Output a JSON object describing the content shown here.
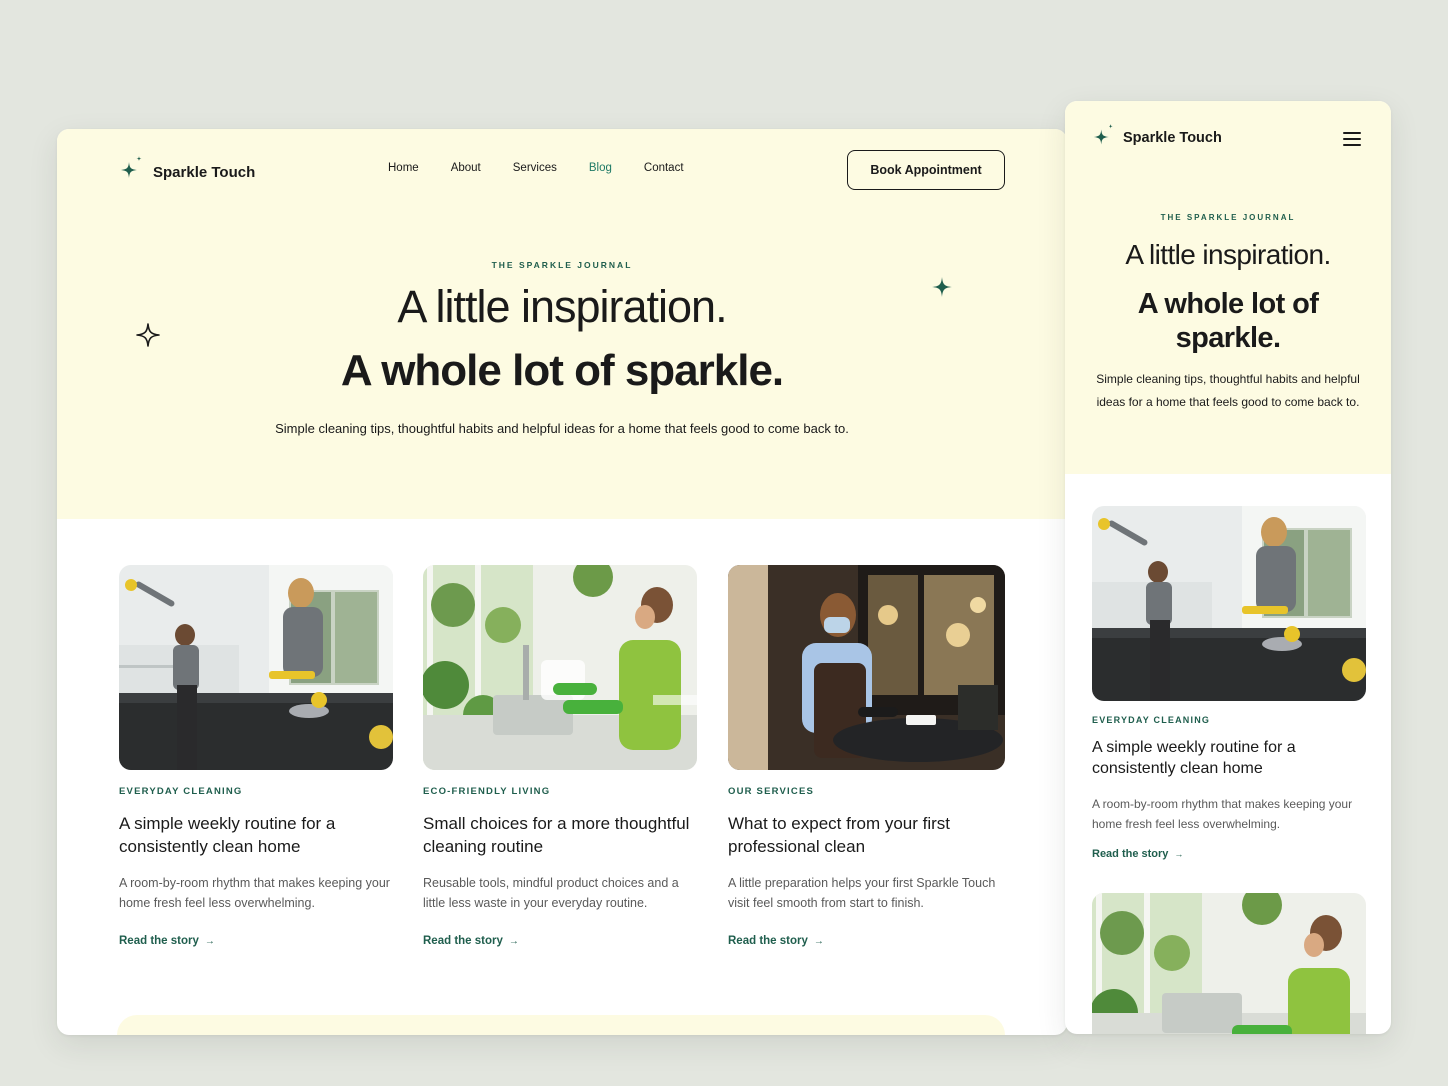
{
  "brand": {
    "name": "Sparkle Touch",
    "accent": "#1f5e4d",
    "active_link": "#1f7a66",
    "hero_bg": "#fdfbe2"
  },
  "nav": {
    "items": [
      {
        "label": "Home"
      },
      {
        "label": "About"
      },
      {
        "label": "Services"
      },
      {
        "label": "Blog",
        "active": true
      },
      {
        "label": "Contact"
      }
    ],
    "cta": "Book Appointment"
  },
  "hero": {
    "eyebrow": "THE SPARKLE JOURNAL",
    "title_light": "A little inspiration.",
    "title_bold": "A whole lot of sparkle.",
    "subtitle": "Simple cleaning tips, thoughtful habits and helpful ideas for a home that feels good to come back to."
  },
  "posts": [
    {
      "category": "EVERYDAY CLEANING",
      "title": "A simple weekly routine for a consistently clean home",
      "excerpt": "A room-by-room rhythm that makes keeping your home fresh feel less overwhelming.",
      "link": "Read the story",
      "image": "Two cleaners in grey polo shirts wiping a kitchen counter and cabinets"
    },
    {
      "category": "ECO-FRIENDLY LIVING",
      "title": "Small choices for a more thoughtful cleaning routine",
      "excerpt": "Reusable tools, mindful product choices and a little less waste in your everyday routine.",
      "link": "Read the story",
      "image": "Woman in green top washing dishes at a kitchen sink with plants"
    },
    {
      "category": "OUR SERVICES",
      "title": "What to expect from your first professional clean",
      "excerpt": "A little preparation helps your first Sparkle Touch visit feel smooth from start to finish.",
      "link": "Read the story",
      "image": "Cleaner in face mask and apron wiping a round cafe table"
    }
  ],
  "mobile": {
    "menu_icon": "hamburger-icon",
    "title_bold_wrapped": "A whole lot of sparkle."
  },
  "icons": {
    "logo": "sparkle-star-icon",
    "arrow": "→"
  }
}
